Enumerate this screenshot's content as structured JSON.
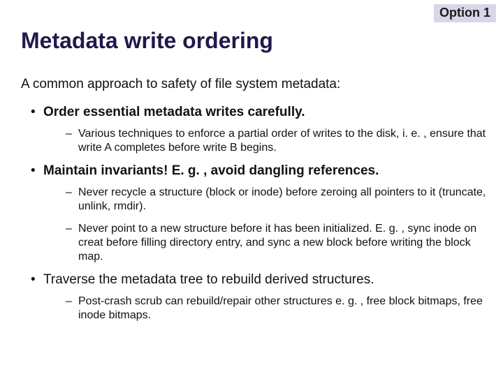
{
  "badge": "Option 1",
  "title": "Metadata write ordering",
  "intro": "A common approach to safety of file system metadata:",
  "bullets": [
    {
      "label": "Order essential metadata writes carefully.",
      "bold": true,
      "sub": [
        "Various techniques to enforce a partial order of writes to the disk, i. e. , ensure that write A completes before write B begins."
      ]
    },
    {
      "label": "Maintain invariants!  E. g. , avoid dangling references.",
      "bold": true,
      "sub": [
        "Never recycle a structure (block or inode) before zeroing all pointers to it (truncate, unlink, rmdir).",
        "Never point to a new structure before it has been initialized. E. g. , sync inode on creat before filling directory entry, and sync a new block before writing the block map."
      ]
    },
    {
      "label": "Traverse the metadata tree to rebuild derived structures.",
      "bold": false,
      "sub": [
        "Post-crash scrub can rebuild/repair other structures e. g. , free block bitmaps, free inode bitmaps."
      ]
    }
  ]
}
